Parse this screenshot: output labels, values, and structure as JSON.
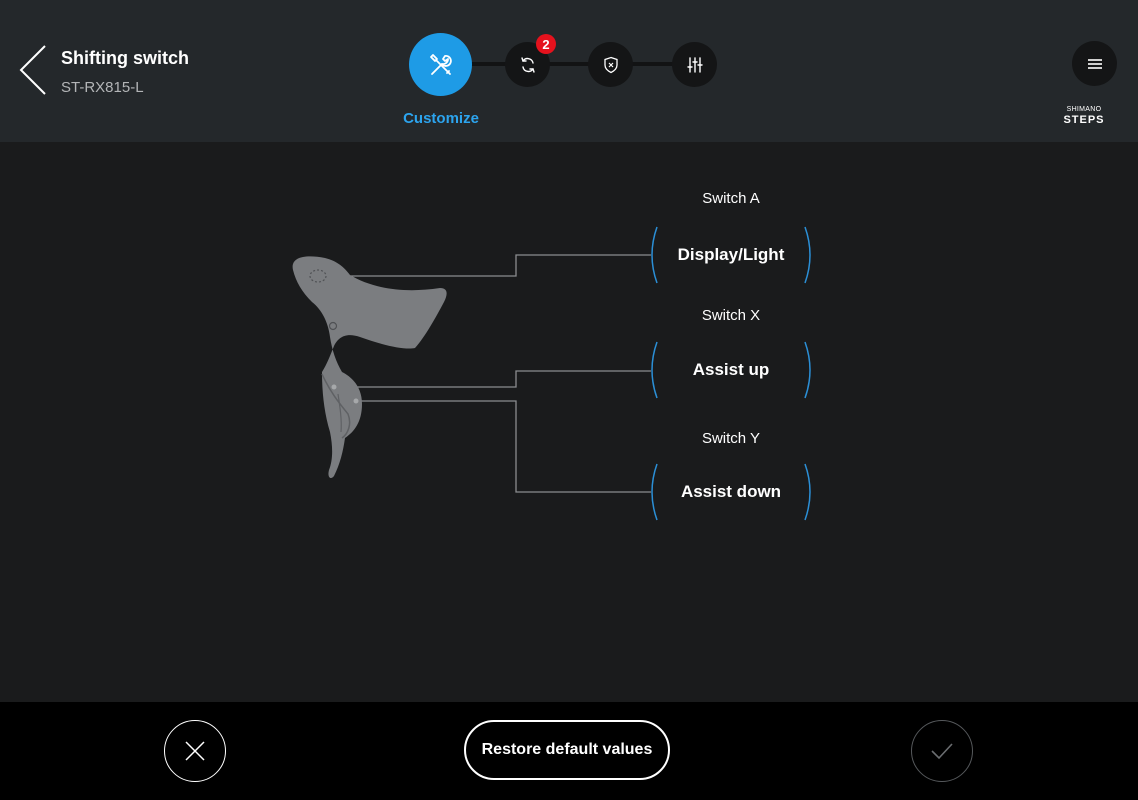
{
  "header": {
    "title": "Shifting switch",
    "subtitle": "ST-RX815-L",
    "active_step_label": "Customize",
    "badge_count": "2",
    "brand_top": "SHIMANO",
    "brand_bottom": "STEPS"
  },
  "steps": [
    {
      "icon": "wrench-screwdriver-icon",
      "active": true
    },
    {
      "icon": "sync-icon",
      "active": false
    },
    {
      "icon": "shield-icon",
      "active": false
    },
    {
      "icon": "sliders-icon",
      "active": false
    }
  ],
  "switches": [
    {
      "label": "Switch A",
      "value": "Display/Light"
    },
    {
      "label": "Switch X",
      "value": "Assist up"
    },
    {
      "label": "Switch Y",
      "value": "Assist down"
    }
  ],
  "footer": {
    "restore_label": "Restore default values"
  },
  "colors": {
    "accent": "#1e9be6",
    "badge": "#e5121d",
    "header_bg": "#24282b",
    "main_bg": "#1a1b1c",
    "footer_bg": "#000000"
  }
}
